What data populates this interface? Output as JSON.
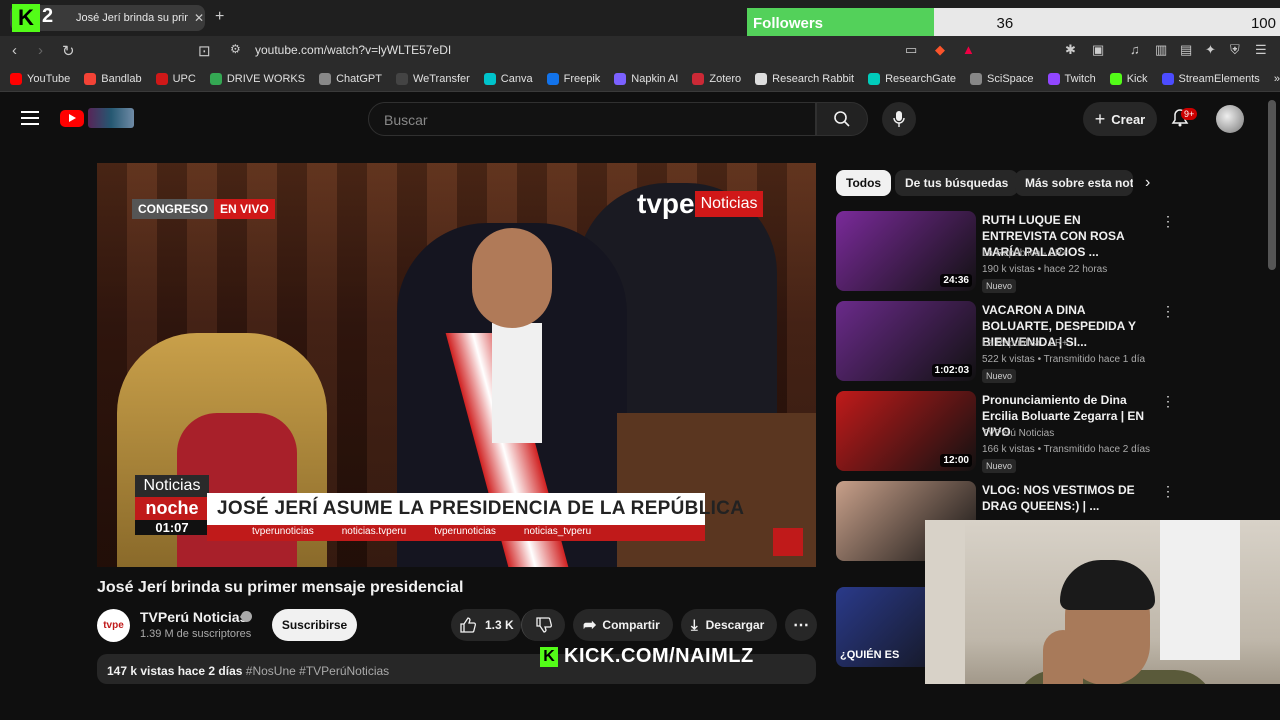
{
  "browser": {
    "tab_title": "José Jerí brinda su primer",
    "kick_number": "2",
    "url": "youtube.com/watch?v=lyWLTE57eDI",
    "bookmarks": [
      {
        "label": "YouTube",
        "color": "#ff0000"
      },
      {
        "label": "Bandlab",
        "color": "#f44336"
      },
      {
        "label": "UPC",
        "color": "#d01818"
      },
      {
        "label": "DRIVE WORKS",
        "color": "#34a853"
      },
      {
        "label": "ChatGPT",
        "color": "#888888"
      },
      {
        "label": "WeTransfer",
        "color": "#444444"
      },
      {
        "label": "Canva",
        "color": "#00c4cc"
      },
      {
        "label": "Freepik",
        "color": "#1273eb"
      },
      {
        "label": "Napkin AI",
        "color": "#7b61ff"
      },
      {
        "label": "Zotero",
        "color": "#cc2936"
      },
      {
        "label": "Research Rabbit",
        "color": "#dddddd"
      },
      {
        "label": "ResearchGate",
        "color": "#00ccbb"
      },
      {
        "label": "SciSpace",
        "color": "#888888"
      },
      {
        "label": "Twitch",
        "color": "#9146ff"
      },
      {
        "label": "Kick",
        "color": "#53fc18"
      },
      {
        "label": "StreamElements",
        "color": "#4c4cff"
      }
    ]
  },
  "followers_widget": {
    "label": "Followers",
    "count": "36",
    "goal": "100",
    "progress_fraction": 0.36
  },
  "youtube": {
    "search_placeholder": "Buscar",
    "create_label": "Crear",
    "notif_count": "9+",
    "video": {
      "title": "José Jerí brinda su primer mensaje presidencial",
      "overlay": {
        "congreso": "CONGRESO",
        "en_vivo": "EN VIVO",
        "brand": "tvpe",
        "brand_sub": "Noticias",
        "box_top": "Noticias",
        "box_mid": "noche",
        "box_time": "01:07",
        "headline": "JOSÉ JERÍ ASUME LA PRESIDENCIA DE LA REPÚBLICA",
        "social": [
          "tvperunoticias",
          "noticias.tvperu",
          "tvperunoticias",
          "noticias_tvperu"
        ]
      }
    },
    "channel": {
      "name": "TVPerú Noticias",
      "subs": "1.39 M de suscriptores",
      "avatar_text": "tvpe",
      "subscribe_label": "Suscribirse"
    },
    "actions": {
      "likes": "1.3 K",
      "share": "Compartir",
      "download": "Descargar"
    },
    "meta": {
      "views_date": "147 k vistas  hace 2 días",
      "tags": "#NosUne #TVPerúNoticias"
    },
    "chips": [
      "Todos",
      "De tus búsquedas",
      "Más sobre esta not"
    ],
    "recommendations": [
      {
        "title": "RUTH LUQUE EN ENTREVISTA CON ROSA MARÍA PALACIOS ...",
        "channel": "La República - LR+",
        "stats": "190 k vistas • hace 22 horas",
        "badge": "Nuevo",
        "duration": "24:36",
        "thumb_color": "#7a2a9a"
      },
      {
        "title": "VACARON A DINA BOLUARTE, DESPEDIDA Y BIENVENIDA | SI...",
        "channel": "La República - LR+",
        "stats": "522 k vistas • Transmitido hace 1 día",
        "badge": "Nuevo",
        "duration": "1:02:03",
        "thumb_color": "#6a2a8a"
      },
      {
        "title": "Pronunciamiento de Dina Ercilia Boluarte Zegarra | EN VIVO",
        "channel": "TVPerú Noticias",
        "stats": "166 k vistas • Transmitido hace 2 días",
        "badge": "Nuevo",
        "duration": "12:00",
        "thumb_color": "#c01a1a"
      },
      {
        "title": "VLOG: NOS VESTIMOS DE DRAG QUEENS:) | ...",
        "channel": "",
        "stats": "",
        "badge": "",
        "duration": "",
        "thumb_color": "#c8a08a"
      },
      {
        "title": "",
        "channel": "",
        "stats": "",
        "badge": "",
        "duration": "",
        "thumb_caption": "¿QUIÉN ES",
        "thumb_color": "#2a3a8a"
      }
    ]
  },
  "stream_overlay": {
    "kick_url": "KICK.COM/NAIMLZ"
  }
}
